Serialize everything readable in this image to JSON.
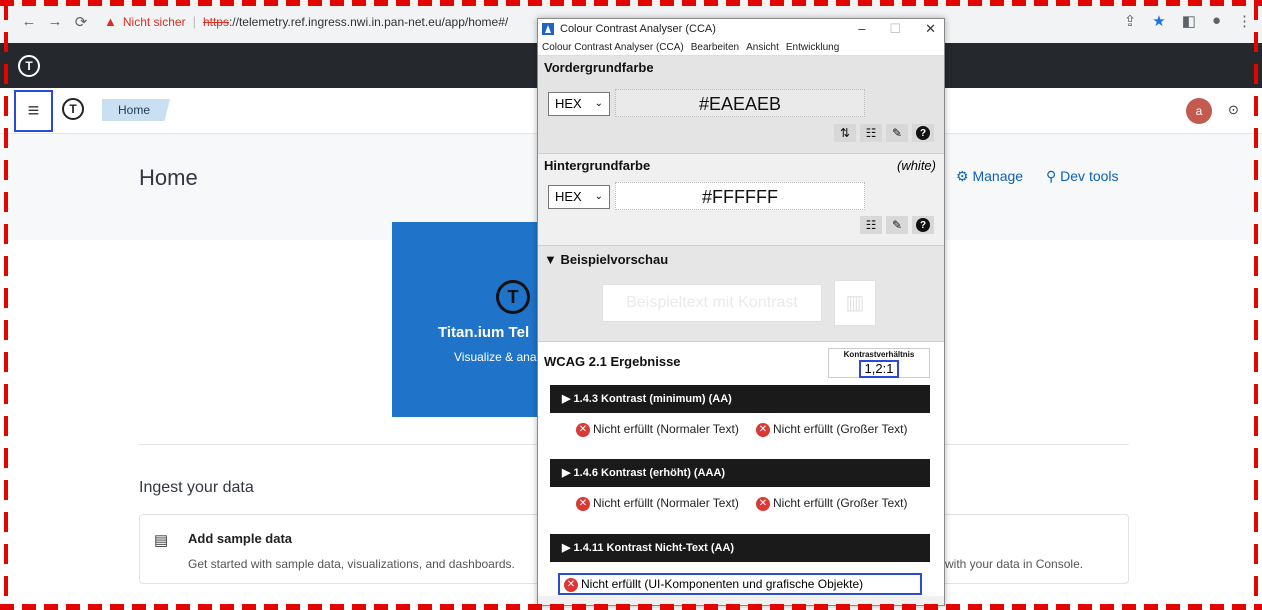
{
  "browser": {
    "warning_text": "Nicht sicher",
    "url_scheme": "https",
    "url_rest": "://telemetry.ref.ingress.nwi.in.pan-net.eu/app/home#/"
  },
  "app": {
    "breadcrumb": "Home",
    "avatar_letter": "a",
    "page_title": "Home",
    "manage_label": "Manage",
    "devtools_label": "Dev tools",
    "hero_title": "Titan.ium Tel",
    "hero_subtitle": "Visualize & ana",
    "ingest_heading": "Ingest your data",
    "sample_card_title": "Add sample data",
    "sample_card_desc": "Get started with sample data, visualizations, and dashboards.",
    "console_text": "with your data in Console."
  },
  "cca": {
    "window_title": "Colour Contrast Analyser (CCA)",
    "menu": [
      "Colour Contrast Analyser (CCA)",
      "Bearbeiten",
      "Ansicht",
      "Entwicklung"
    ],
    "foreground_heading": "Vordergrundfarbe",
    "foreground_format": "HEX",
    "foreground_value": "#EAEAEB",
    "background_heading": "Hintergrundfarbe",
    "background_name": "(white)",
    "background_format": "HEX",
    "background_value": "#FFFFFF",
    "preview_heading": "▼ Beispielvorschau",
    "preview_text": "Beispieltext mit Kontrast",
    "results_heading": "WCAG 2.1 Ergebnisse",
    "ratio_label": "Kontrastverhältnis",
    "ratio_value": "1,2:1",
    "criteria": [
      {
        "label": "▶ 1.4.3 Kontrast (minimum) (AA)",
        "left": "Nicht erfüllt (Normaler Text)",
        "right": "Nicht erfüllt (Großer Text)"
      },
      {
        "label": "▶ 1.4.6 Kontrast (erhöht) (AAA)",
        "left": "Nicht erfüllt (Normaler Text)",
        "right": "Nicht erfüllt (Großer Text)"
      },
      {
        "label": "▶ 1.4.11 Kontrast Nicht-Text (AA)",
        "result": "Nicht erfüllt (UI-Komponenten und grafische Objekte)"
      }
    ]
  },
  "colors": {
    "accent_blue": "#2a4bd7",
    "fail_red": "#d93a36",
    "annotation_red": "#e10600",
    "hero_blue": "#1f73c8"
  }
}
